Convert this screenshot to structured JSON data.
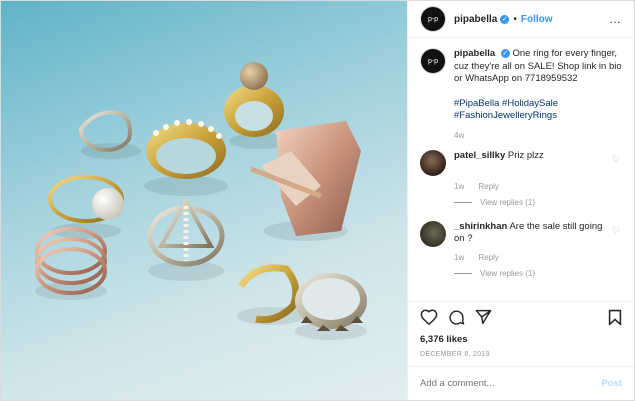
{
  "header": {
    "avatar_text": "p-p",
    "username": "pipabella",
    "verified_mark": "✓",
    "separator": "•",
    "follow_label": "Follow",
    "more_icon": "…"
  },
  "caption": {
    "username": "pipabella",
    "text": "One ring for every finger, cuz they're all on SALE! Shop link in bio or WhatsApp on 7718959532",
    "hashtags": "#PipaBella #HolidaySale #FashionJewelleryRings",
    "age": "4w"
  },
  "comments": [
    {
      "username": "patel_sillky",
      "text": "Priz plzz",
      "age": "1w",
      "reply_label": "Reply",
      "view_replies": "View replies (1)"
    },
    {
      "username": "_shirinkhan",
      "text": "Are the sale still going on ?",
      "age": "1w",
      "reply_label": "Reply",
      "view_replies": "View replies (1)"
    }
  ],
  "stats": {
    "likes": "6,376 likes",
    "date": "DECEMBER 8, 2019"
  },
  "add_comment": {
    "placeholder": "Add a comment...",
    "post_label": "Post"
  },
  "icons": {
    "like": "heart-icon",
    "comment": "comment-icon",
    "share": "share-icon",
    "save": "bookmark-icon"
  },
  "colors": {
    "link_blue": "#3897f0",
    "hashtag": "#003569",
    "post_button_disabled": "#b2dffc"
  }
}
